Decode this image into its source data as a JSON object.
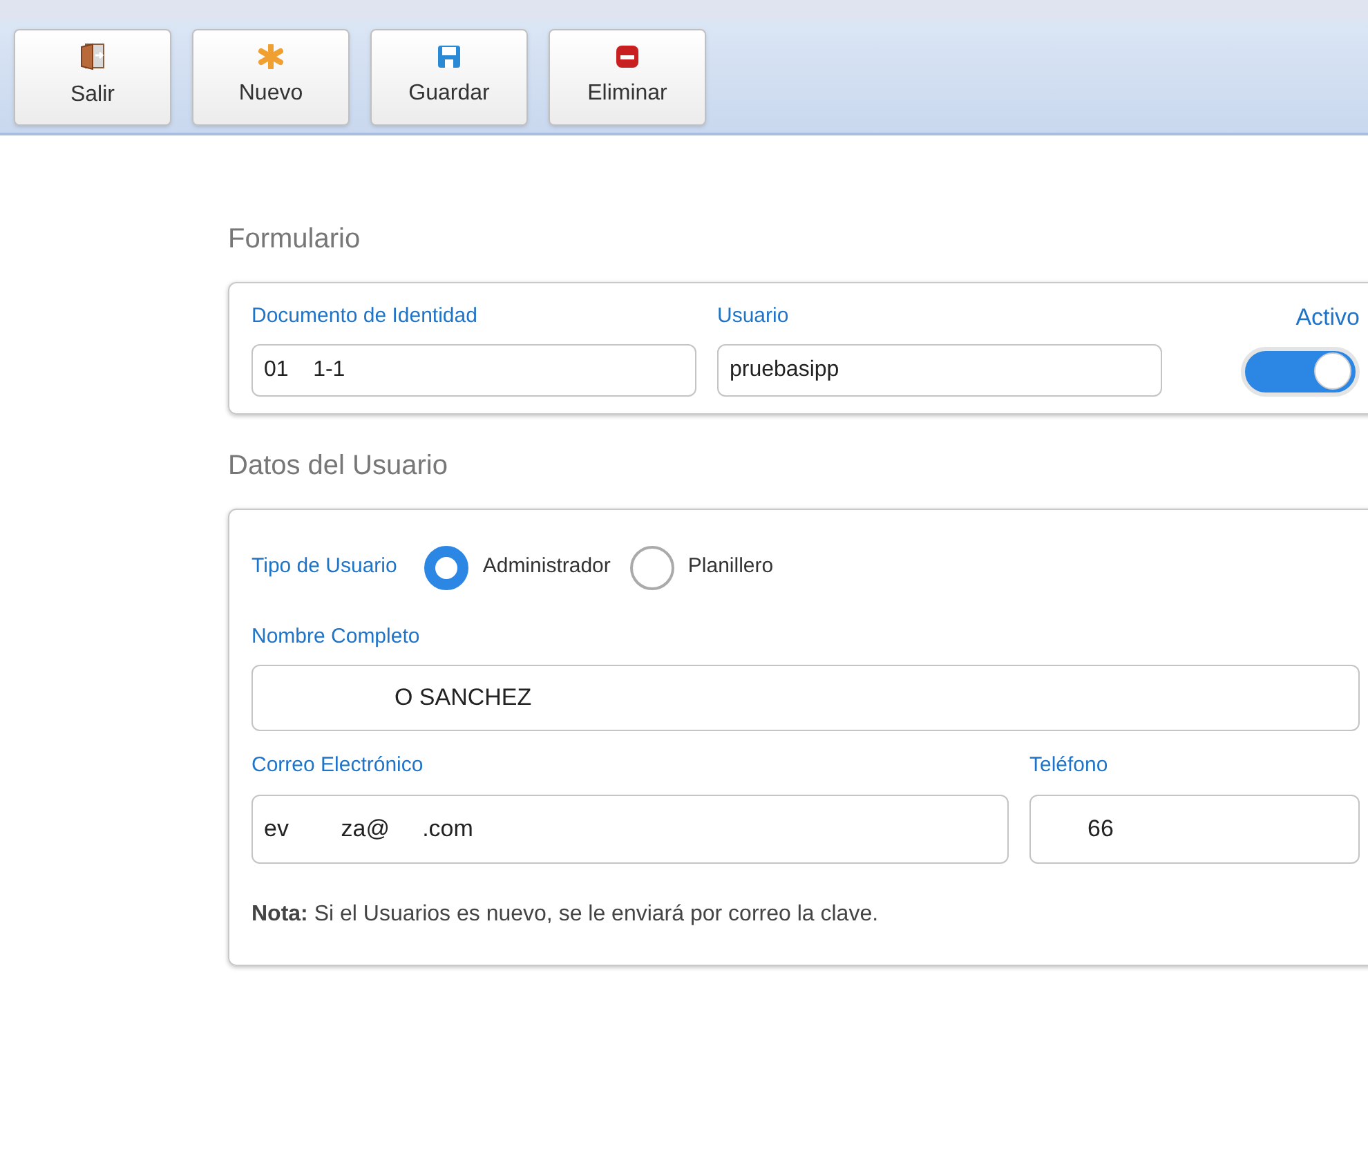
{
  "toolbar": [
    {
      "kind": "exit",
      "label": "Salir"
    },
    {
      "kind": "new",
      "label": "Nuevo"
    },
    {
      "kind": "save",
      "label": "Guardar"
    },
    {
      "kind": "delete",
      "label": "Eliminar"
    }
  ],
  "form_section": {
    "title": "Formulario",
    "document_label": "Documento de Identidad",
    "document_value": "01    1-1",
    "user_label": "Usuario",
    "user_value": "pruebasipp",
    "active_label": "Activo",
    "active_on": true
  },
  "user_section": {
    "title": "Datos del Usuario",
    "type_label": "Tipo de Usuario",
    "types": [
      {
        "label": "Administrador",
        "selected": true
      },
      {
        "label": "Planillero",
        "selected": false
      }
    ],
    "name_label": "Nombre Completo",
    "name_value": "                    O SANCHEZ",
    "email_label": "Correo Electrónico",
    "email_value": "ev        za@     .com",
    "phone_label": "Teléfono",
    "phone_value": "       66",
    "note": "**Nota:** Si el Usuarios es nuevo, se le enviará por correo la clave."
  }
}
